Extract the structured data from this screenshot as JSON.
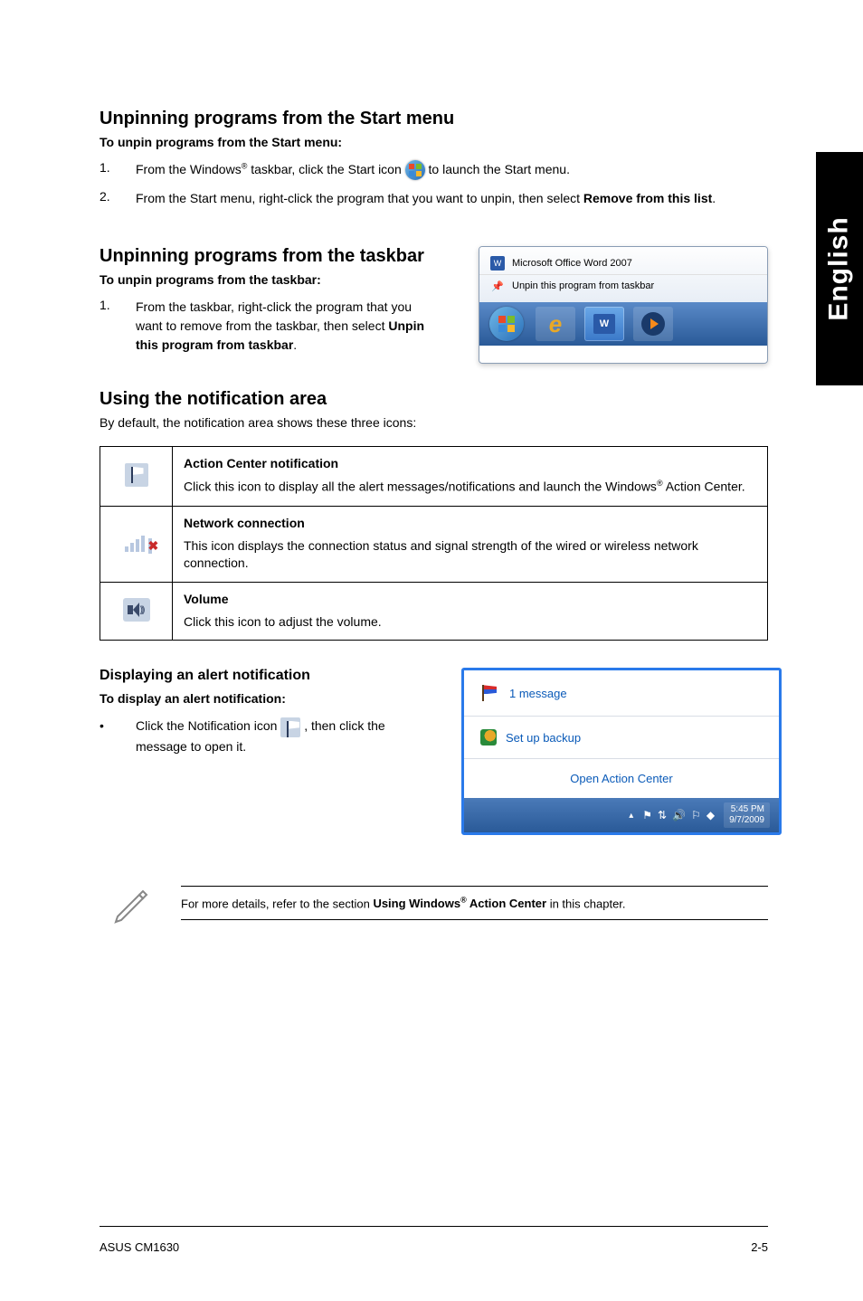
{
  "sideTab": "English",
  "section1": {
    "heading": "Unpinning programs from the Start menu",
    "sub": "To unpin programs from the Start menu:",
    "step1_a": "From the Windows",
    "step1_b": " taskbar, click the Start icon ",
    "step1_c": " to launch the Start menu.",
    "step2_a": "From the Start menu, right-click the program that you want to unpin, then select ",
    "step2_b": "Remove from this list",
    "step2_c": "."
  },
  "section2": {
    "heading": "Unpinning programs from the taskbar",
    "sub": "To unpin programs from the taskbar:",
    "step1_a": "From the taskbar, right-click the program that you want to remove from the taskbar, then select ",
    "step1_b": "Unpin this program from taskbar",
    "step1_c": ".",
    "menu_item1": "Microsoft Office Word 2007",
    "menu_item2": "Unpin this program from taskbar"
  },
  "section3": {
    "heading": "Using the notification area",
    "intro": "By default, the notification area shows these three icons:",
    "row1_title": "Action Center notification",
    "row1_desc_a": "Click this icon to display all the alert messages/notifications and launch the Windows",
    "row1_desc_b": " Action Center.",
    "row2_title": "Network connection",
    "row2_desc": "This icon displays the connection status and signal strength of the wired or wireless network connection.",
    "row3_title": "Volume",
    "row3_desc": "Click this icon to adjust the volume."
  },
  "section4": {
    "sub_heading": "Displaying an alert notification",
    "sub_bold": "To display an alert notification:",
    "bullet_a": "Click the Notification icon ",
    "bullet_b": ", then click the message to open it.",
    "notif_msg": "1 message",
    "notif_backup": "Set up backup",
    "notif_open": "Open Action Center",
    "tray_time": "5:45 PM",
    "tray_date": "9/7/2009"
  },
  "note": {
    "text_a": "For more details, refer to the section ",
    "text_b": "Using Windows",
    "text_c": " Action Center",
    "text_d": " in this chapter."
  },
  "footer": {
    "left": "ASUS CM1630",
    "right": "2-5"
  }
}
